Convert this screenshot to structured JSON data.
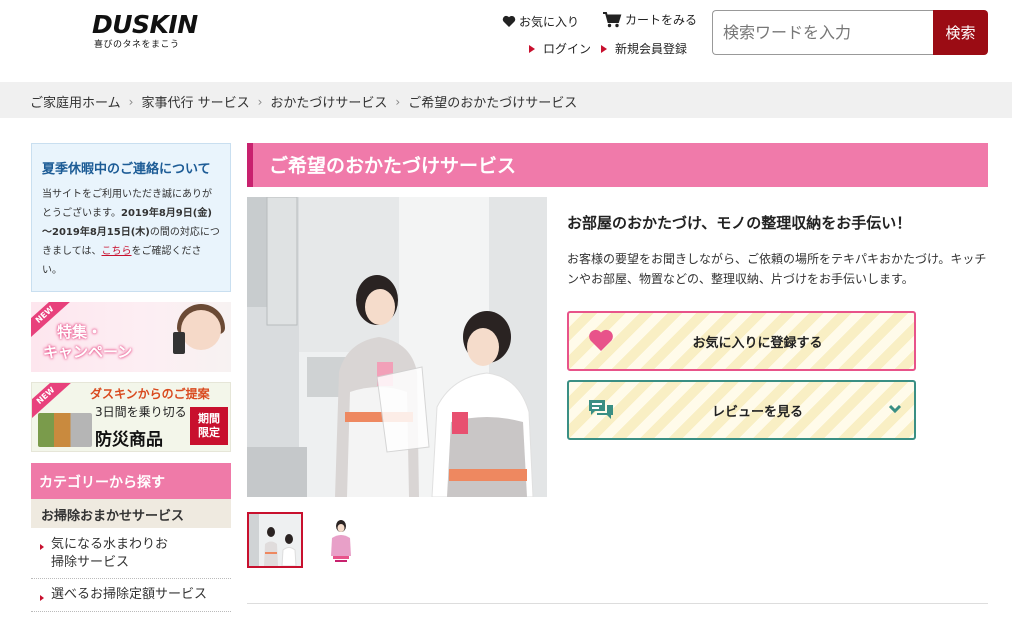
{
  "header": {
    "logo": "DUSKIN",
    "logo_tagline": "喜びのタネをまこう",
    "favorites_label": "お気に入り",
    "cart_label": "カートをみる",
    "login_label": "ログイン",
    "register_label": "新規会員登録",
    "search_placeholder": "検索ワードを入力",
    "search_button": "検索"
  },
  "breadcrumb": [
    "ご家庭用ホーム",
    "家事代行 サービス",
    "おかたづけサービス",
    "ご希望のおかたづけサービス"
  ],
  "sidebar": {
    "notice": {
      "title": "夏季休暇中のご連絡について",
      "line1": "当サイトをご利用いただき誠にありがとうございます。",
      "dates": "2019年8月9日(金)～2019年8月15日(木)",
      "line2": "の間の対応につきましては、",
      "link": "こちら",
      "line3": "をご確認ください。"
    },
    "banner_special": {
      "ribbon": "NEW",
      "text_line1": "特集・",
      "text_line2": "キャンペーン"
    },
    "banner_disaster": {
      "ribbon": "NEW",
      "line1": "ダスキンからのご提案",
      "line2": "3日間を乗り切る",
      "line3": "防災商品",
      "badge_line1": "期間",
      "badge_line2": "限定"
    },
    "category_heading": "カテゴリーから探す",
    "category_sub": "お掃除おまかせサービス",
    "category_items": [
      "気になる水まわりお掃除サービス",
      "選べるお掃除定額サービス"
    ]
  },
  "main": {
    "title": "ご希望のおかたづけサービス",
    "headline": "お部屋のおかたづけ、モノの整理収納をお手伝い！",
    "description": "お客様の要望をお聞きしながら、ご依頼の場所をテキパキおかたづけ。キッチンやお部屋、物置などの、整理収納、片づけをお手伝いします。",
    "favorite_button": "お気に入りに登録する",
    "review_button": "レビューを見る"
  },
  "colors": {
    "brand_red": "#9b0c14",
    "pink": "#f07aaa",
    "teal": "#3a8f84"
  }
}
